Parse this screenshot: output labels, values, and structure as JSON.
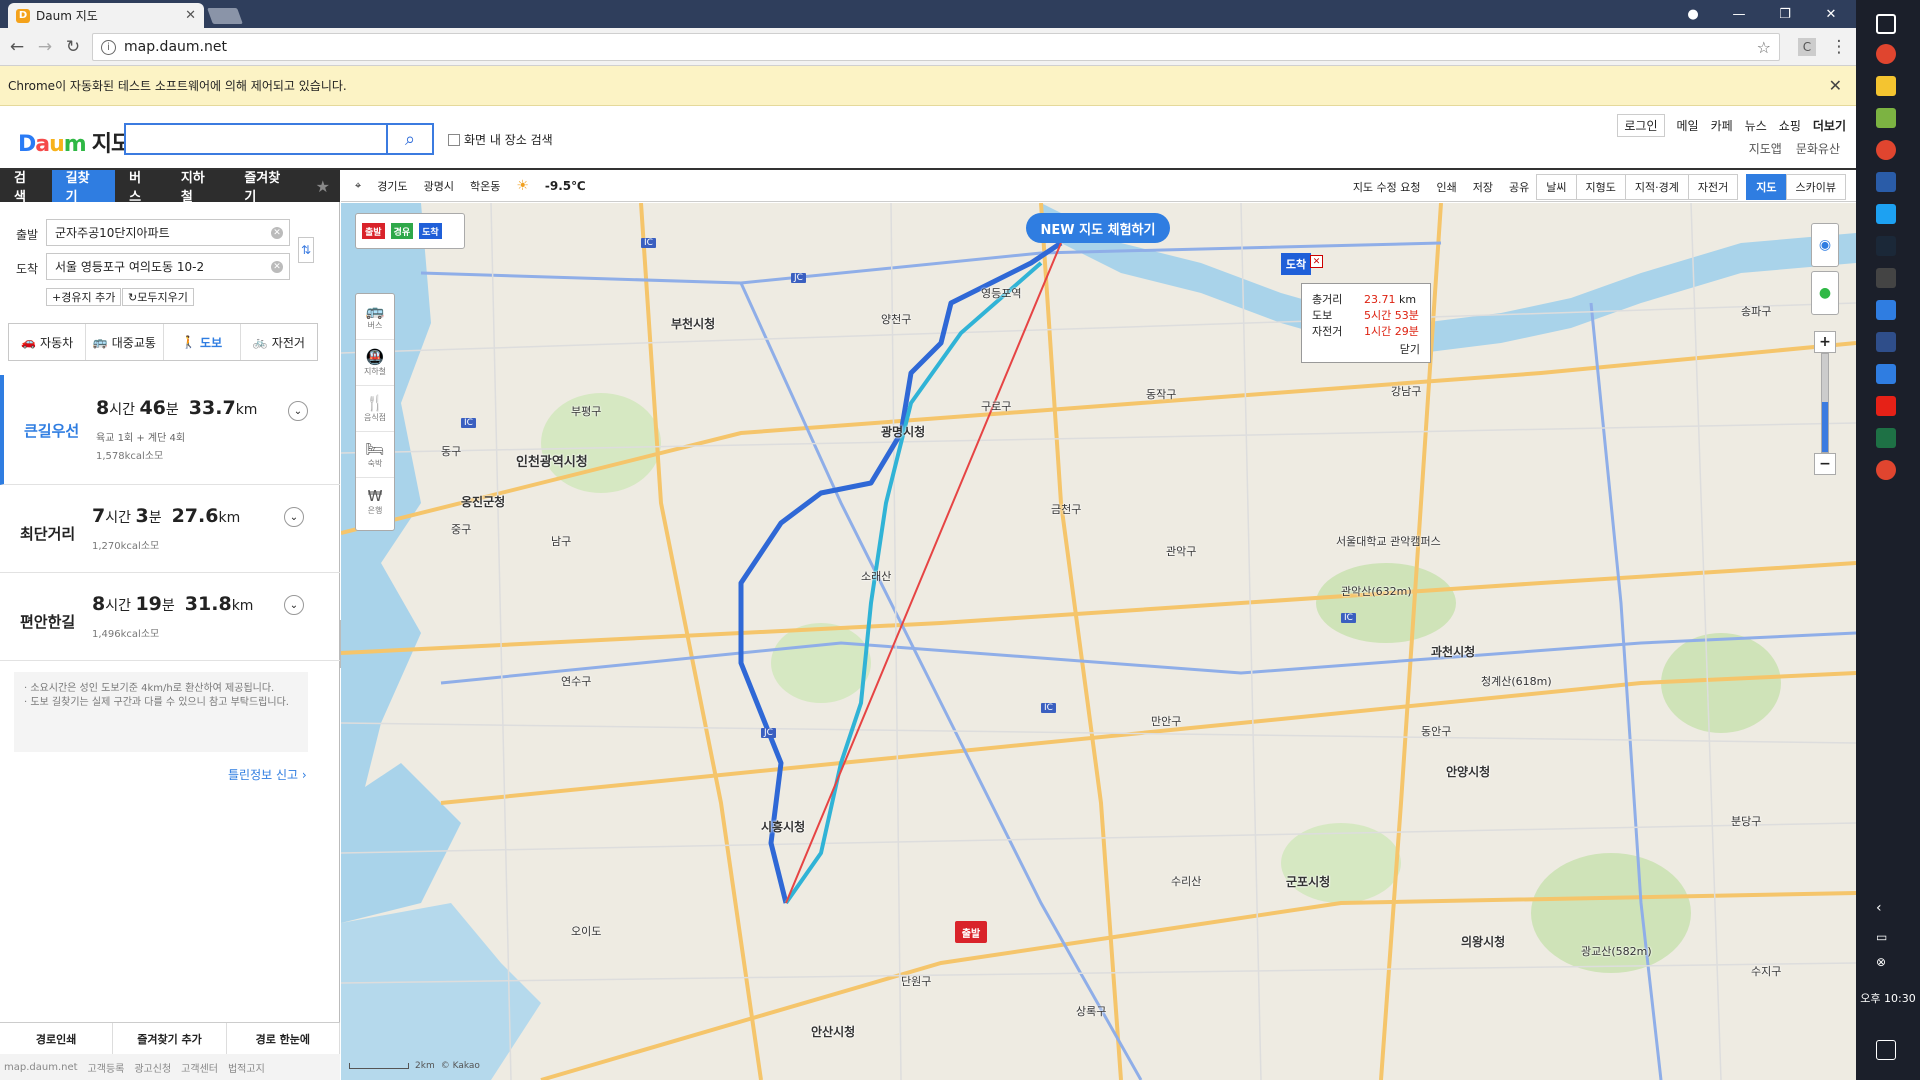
{
  "browser": {
    "tab_title": "Daum 지도",
    "tab_favicon": "D",
    "url": "map.daum.net",
    "infobar_text": "Chrome이 자동화된 테스트 소프트웨어에 의해 제어되고 있습니다.",
    "window_controls": [
      "—",
      "❐",
      "✕"
    ]
  },
  "header": {
    "logo_letters": [
      "D",
      "a",
      "u",
      "m"
    ],
    "logo_suffix": "지도",
    "search_value": "",
    "area_search_label": "화면 내 장소 검색",
    "links": [
      "로그인",
      "메일",
      "카페",
      "뉴스",
      "쇼핑",
      "더보기"
    ],
    "sublinks": [
      "지도앱",
      "문화유산"
    ]
  },
  "left_menu": {
    "items": [
      "검색",
      "길찾기",
      "버스",
      "지하철",
      "즐겨찾기"
    ],
    "active": "길찾기"
  },
  "route_form": {
    "start_label": "출발",
    "start_value": "군자주공10단지아파트",
    "end_label": "도착",
    "end_value": "서울 영등포구 여의도동 10-2",
    "add_waypoint": "경유지 추가",
    "clear_all": "모두지우기",
    "modes": [
      "자동차",
      "대중교통",
      "도보",
      "자전거"
    ],
    "active_mode": "도보"
  },
  "results": [
    {
      "name": "큰길우선",
      "hours": "8",
      "hours_unit": "시간",
      "mins": "46",
      "mins_unit": "분",
      "dist": "33.7",
      "dist_unit": "km",
      "sub": "육교 1회 + 계단 4회",
      "kcal": "1,578kcal소모",
      "selected": true
    },
    {
      "name": "최단거리",
      "hours": "7",
      "hours_unit": "시간",
      "mins": "3",
      "mins_unit": "분",
      "dist": "27.6",
      "dist_unit": "km",
      "sub": "",
      "kcal": "1,270kcal소모",
      "selected": false
    },
    {
      "name": "편안한길",
      "hours": "8",
      "hours_unit": "시간",
      "mins": "19",
      "mins_unit": "분",
      "dist": "31.8",
      "dist_unit": "km",
      "sub": "",
      "kcal": "1,496kcal소모",
      "selected": false
    }
  ],
  "note_lines": [
    "· 소요시간은 성인 도보기준 4km/h로 환산하여 제공됩니다.",
    "· 도보 길찾기는 실제 구간과 다를 수 있으니 참고 부탁드립니다."
  ],
  "report_link": "틀린정보 신고 ›",
  "bottom_buttons": [
    "경로인쇄",
    "즐겨찾기 추가",
    "경로 한눈에"
  ],
  "footer_links": [
    "map.daum.net",
    "고객등록",
    "광고신청",
    "고객센터",
    "법적고지"
  ],
  "map_toolbar": {
    "region": [
      "경기도",
      "광명시",
      "학온동"
    ],
    "temperature": "-9.5℃",
    "tools": [
      "지도 수정 요청",
      "인쇄",
      "저장",
      "공유"
    ],
    "layers": [
      "날씨",
      "지형도",
      "지적·경계",
      "자전거"
    ],
    "views": [
      "지도",
      "스카이뷰"
    ],
    "active_view": "지도"
  },
  "map": {
    "new_map_button": "NEW 지도 체험하기",
    "flags": [
      "출발",
      "경유",
      "도착"
    ],
    "category_labels": [
      "버스",
      "지하철",
      "음식점",
      "숙박",
      "은행"
    ],
    "distance_box": {
      "total_label": "총거리",
      "total_value": "23.71",
      "total_unit": "km",
      "walk_label": "도보",
      "walk_value": "5시간 53분",
      "bike_label": "자전거",
      "bike_value": "1시간 29분",
      "close": "닫기"
    },
    "start_pin": "출발",
    "end_pin": "도착",
    "scale_label": "2km",
    "copyright": "© Kakao",
    "cities": [
      "부천시청",
      "인천광역시청",
      "광명시청",
      "시흥시청",
      "안산시청",
      "군포시청",
      "안양시청",
      "의왕시청",
      "과천시청",
      "옹진군청"
    ],
    "places": [
      "양천구",
      "부평구",
      "금천구",
      "구로구",
      "동작구",
      "관악구",
      "강남구",
      "송파구",
      "연수구",
      "남구",
      "중구",
      "동구",
      "단원구",
      "상록구",
      "만안구",
      "동안구",
      "수지구",
      "분당구",
      "오이도",
      "영등포역",
      "서울대학교 관악캠퍼스",
      "소래산",
      "수리산",
      "광교산(582m)",
      "청계산(618m)",
      "관악산(632m)"
    ]
  },
  "taskbar": {
    "time": "오후 10:30"
  }
}
